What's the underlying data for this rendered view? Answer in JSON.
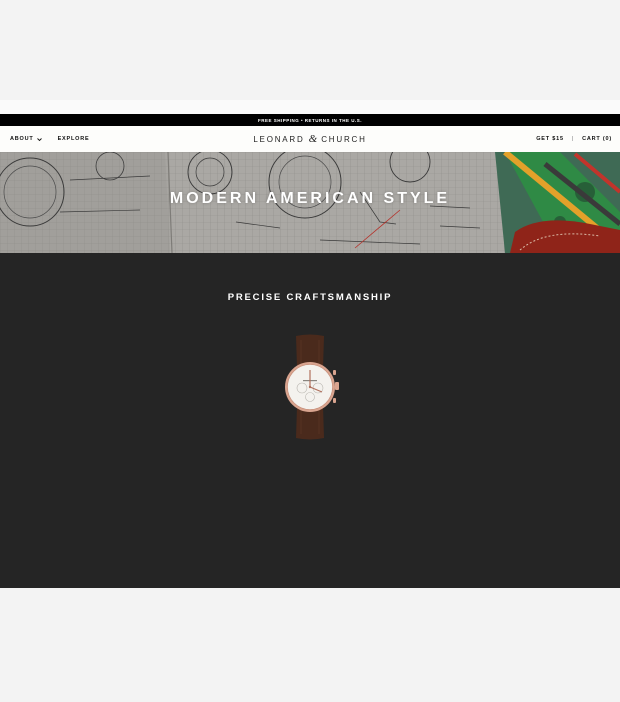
{
  "promo": {
    "text": "FREE SHIPPING • RETURNS IN THE U.S."
  },
  "nav": {
    "about_label": "ABOUT",
    "explore_label": "EXPLORE",
    "logo_left": "LEONARD ",
    "logo_amp": "&",
    "logo_right": " CHURCH",
    "get_label": "GET $15",
    "separator": "|",
    "cart_label": "CART (0)"
  },
  "hero": {
    "title": "MODERN AMERICAN STYLE"
  },
  "section": {
    "title": "PRECISE CRAFTSMANSHIP"
  },
  "colors": {
    "page_background": "#f3f3f3",
    "section_background": "#252525",
    "promo_background": "#000000",
    "nav_background": "#fdfdfb",
    "watch_strap": "#4a2a1c",
    "watch_case": "#d9a48f"
  },
  "icons": {
    "about_dropdown": "chevron-down-icon",
    "product": "watch-icon"
  }
}
